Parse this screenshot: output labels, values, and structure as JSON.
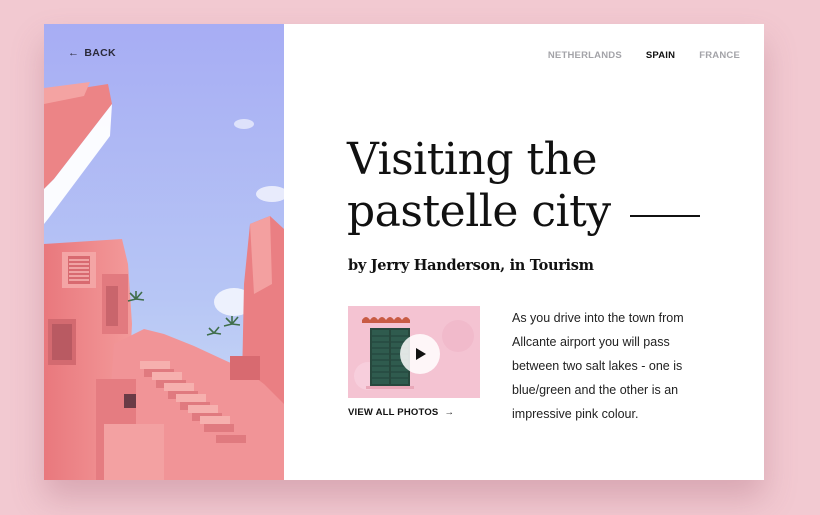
{
  "header": {
    "back_label": "BACK",
    "nav": [
      {
        "label": "NETHERLANDS",
        "active": false
      },
      {
        "label": "SPAIN",
        "active": true
      },
      {
        "label": "FRANCE",
        "active": false
      }
    ]
  },
  "article": {
    "title_line1": "Visiting the",
    "title_line2": "pastelle city",
    "byline": "by Jerry Handerson, in Tourism",
    "view_all_label": "VIEW ALL PHOTOS",
    "description": "As you drive into the town from Allcante airport you will pass between two salt lakes - one is blue/green and the other is an impressive pink colour."
  },
  "icons": {
    "back": "arrow-left-icon",
    "view_all": "arrow-right-icon",
    "play": "play-icon"
  },
  "colors": {
    "page_background": "#f2c9d1",
    "card_background": "#ffffff",
    "sky_top": "#a7adf4",
    "sky_bottom": "#c8dcf6",
    "building_pink": "#ee8e90",
    "shutter_green": "#2f5b4e",
    "text_dark": "#111111",
    "nav_inactive": "#a3a3a8"
  }
}
